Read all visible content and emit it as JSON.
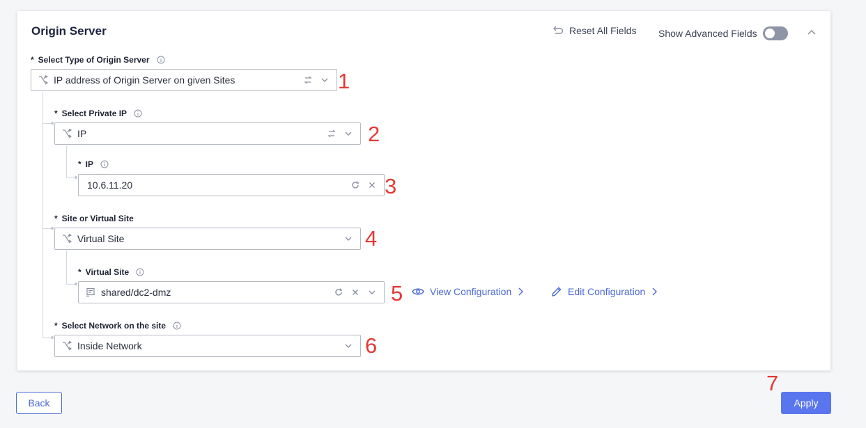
{
  "section": {
    "title": "Origin Server",
    "reset_label": "Reset All Fields",
    "advanced_label": "Show Advanced Fields",
    "advanced_enabled": false
  },
  "fields": {
    "origin_type": {
      "required": "*",
      "label": "Select Type of Origin Server",
      "value": "IP address of Origin Server on given Sites"
    },
    "private_ip": {
      "required": "*",
      "label": "Select Private IP",
      "value": "IP"
    },
    "ip": {
      "required": "*",
      "label": "IP",
      "value": "10.6.11.20"
    },
    "site_type": {
      "required": "*",
      "label": "Site or Virtual Site",
      "value": "Virtual Site"
    },
    "virtual_site": {
      "required": "*",
      "label": "Virtual Site",
      "value": "shared/dc2-dmz"
    },
    "network": {
      "required": "*",
      "label": "Select Network on the site",
      "value": "Inside Network"
    }
  },
  "links": {
    "view": "View Configuration",
    "edit": "Edit Configuration"
  },
  "annotations": [
    "1",
    "2",
    "3",
    "4",
    "5",
    "6",
    "7"
  ],
  "buttons": {
    "back": "Back",
    "apply": "Apply"
  },
  "colors": {
    "accent": "#5a76ee",
    "link": "#4b6bd6",
    "annotation": "#e53935",
    "title": "#1c2340"
  }
}
